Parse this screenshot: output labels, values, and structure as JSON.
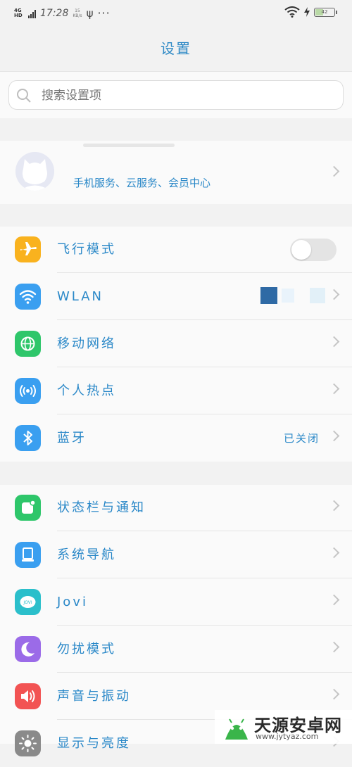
{
  "status_bar": {
    "network": "4G HD",
    "time": "17:28",
    "speed_value": "15",
    "speed_unit": "KB/s",
    "usb_glyph": "ψ",
    "more_glyph": "···",
    "battery_text": "42",
    "battery_level_percent": 42
  },
  "header": {
    "title": "设置"
  },
  "search": {
    "placeholder": "搜索设置项"
  },
  "account": {
    "subtitle": "手机服务、云服务、会员中心"
  },
  "group1": [
    {
      "label": "飞行模式",
      "control": "toggle",
      "toggle_on": false,
      "icon": "airplane-icon",
      "color": "#f9b21e"
    },
    {
      "label": "WLAN",
      "control": "chevron",
      "icon": "wifi-icon",
      "color": "#3a9ff0"
    },
    {
      "label": "移动网络",
      "control": "chevron",
      "icon": "globe-icon",
      "color": "#2ec66a"
    },
    {
      "label": "个人热点",
      "control": "chevron",
      "icon": "hotspot-icon",
      "color": "#3a9ff0"
    },
    {
      "label": "蓝牙",
      "control": "chevron",
      "value": "已关闭",
      "icon": "bluetooth-icon",
      "color": "#3a9ff0"
    }
  ],
  "group2": [
    {
      "label": "状态栏与通知",
      "icon": "notification-icon",
      "color": "#2ec66a"
    },
    {
      "label": "系统导航",
      "icon": "navigation-icon",
      "color": "#3a9ff0"
    },
    {
      "label": "Jovi",
      "icon": "jovi-icon",
      "color": "#2bbfcb",
      "icon_text": "JOVI"
    },
    {
      "label": "勿扰模式",
      "icon": "moon-icon",
      "color": "#9b6be8"
    },
    {
      "label": "声音与振动",
      "icon": "speaker-icon",
      "color": "#f25353"
    },
    {
      "label": "显示与亮度",
      "icon": "brightness-icon",
      "color": "#8a8a8a"
    }
  ],
  "watermark": {
    "name": "天源安卓网",
    "url": "www.jytyaz.com"
  }
}
